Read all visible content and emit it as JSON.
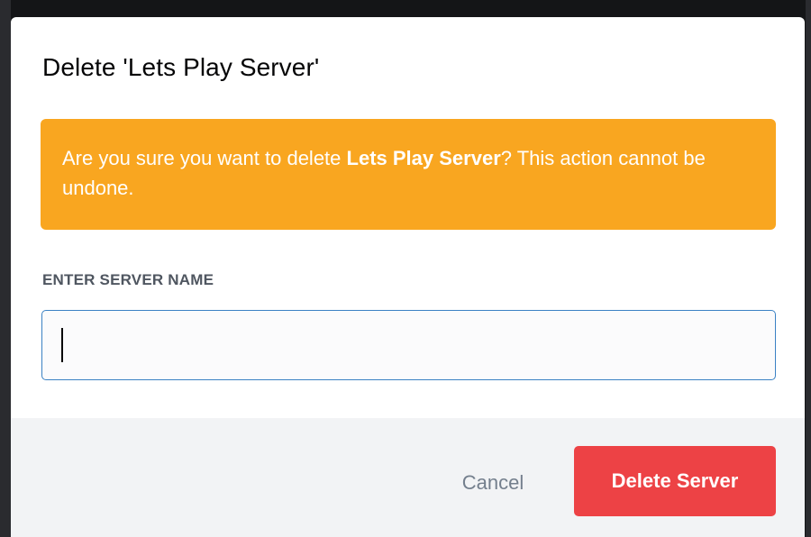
{
  "modal": {
    "title": "Delete 'Lets Play Server'",
    "warning": {
      "prefix": "Are you sure you want to delete ",
      "server_name": "Lets Play Server",
      "suffix": "? This action cannot be undone."
    },
    "field_label": "ENTER SERVER NAME",
    "input_value": "",
    "input_placeholder": "",
    "cancel_label": "Cancel",
    "delete_label": "Delete Server"
  },
  "colors": {
    "warning_background": "#f9a620",
    "danger_button": "#ed4245",
    "input_focus_border": "#3b82c4",
    "footer_background": "#f2f3f5"
  }
}
